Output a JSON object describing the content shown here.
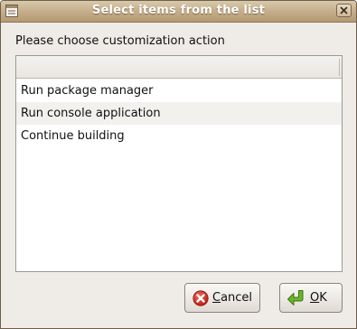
{
  "window": {
    "title": "Select items from the list"
  },
  "prompt": "Please choose customization action",
  "list": {
    "items": [
      "Run package manager",
      "Run console application",
      "Continue building"
    ]
  },
  "buttons": {
    "cancel": {
      "mnemonic": "C",
      "rest": "ancel"
    },
    "ok": {
      "mnemonic": "O",
      "rest": "K"
    }
  },
  "colors": {
    "titlebar": "#c6b08d",
    "window_bg": "#efebe7",
    "list_bg": "#ffffff",
    "row_alt": "#f3f1ee",
    "cancel_icon": "#cc2a1f",
    "ok_icon": "#5ea11f"
  },
  "icons": {
    "title": "window-menu-icon",
    "close": "close-icon",
    "cancel": "cancel-icon",
    "ok": "ok-arrow-icon"
  }
}
